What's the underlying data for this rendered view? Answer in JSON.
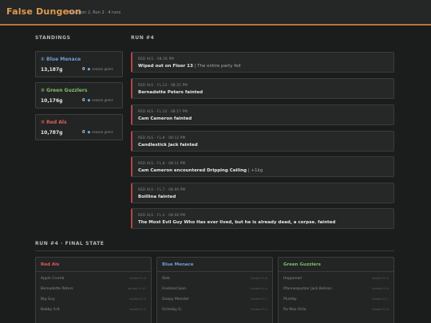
{
  "app": {
    "title": "False Dungeon",
    "subtitle": "Evolution 2, Run 2 · 4 runs"
  },
  "standings": {
    "heading": "STANDINGS",
    "teams": [
      {
        "name": "① Blue Menace",
        "gold": "13,187g",
        "gems": "0",
        "gems_label": "season gems",
        "color": "#6f9fd8"
      },
      {
        "name": "② Green Guzzlers",
        "gold": "10,176g",
        "gems": "0",
        "gems_label": "season gems",
        "color": "#7fbf6a"
      },
      {
        "name": "③ Red Als",
        "gold": "10,787g",
        "gems": "0",
        "gems_label": "season gems",
        "color": "#d9605a"
      }
    ]
  },
  "run": {
    "heading": "RUN #4",
    "events": [
      {
        "meta": "RED ALS · 08:26 PM",
        "text": "Wiped out on Floor 13",
        "extra": " | The entire party fell"
      },
      {
        "meta": "RED ALS · FL.13 · 08:25 PM",
        "text": "Bernadette Peters fainted",
        "extra": ""
      },
      {
        "meta": "RED ALS · FL.10 · 08:17 PM",
        "text": "Cam Cameron fainted",
        "extra": ""
      },
      {
        "meta": "RED ALS · FL.8 · 08:12 PM",
        "text": "Candlestick Jack fainted",
        "extra": ""
      },
      {
        "meta": "RED ALS · FL.8 · 08:11 PM",
        "text": "Cam Cameron encountered Dripping Ceiling",
        "extra": " | +1kg"
      },
      {
        "meta": "RED ALS · FL.7 · 08:09 PM",
        "text": "Boillina fainted",
        "extra": ""
      },
      {
        "meta": "RED ALS · FL.4 · 08:08 PM",
        "text": "The Most Evil Guy Who Has ever lived, but he is already dead, a corpse. fainted",
        "extra": ""
      }
    ]
  },
  "final_state": {
    "heading": "RUN #4 · FINAL STATE",
    "teams": [
      {
        "name": "Red Als",
        "color": "#d9605a",
        "members": [
          {
            "name": "Apple Crumb",
            "status": "fainted FL.6"
          },
          {
            "name": "Bernadette Peters",
            "status": "fainted FL.13"
          },
          {
            "name": "Big Guy",
            "status": "fainted FL.9"
          },
          {
            "name": "Bobby Arit",
            "status": "fainted FL.5"
          }
        ]
      },
      {
        "name": "Blue Menace",
        "color": "#6f9fd8",
        "members": [
          {
            "name": "Sleb",
            "status": "fainted FL.6"
          },
          {
            "name": "Freckled Sam",
            "status": "fainted FL.4"
          },
          {
            "name": "Goopy Monster",
            "status": "fainted FL.7"
          },
          {
            "name": "Grimsby G.",
            "status": "fainted FL.2"
          }
        ]
      },
      {
        "name": "Green Guzzlers",
        "color": "#7fbf6a",
        "members": [
          {
            "name": "Hoppenarl",
            "status": "fainted FL.9"
          },
          {
            "name": "Pfannenputzer Jack Behren",
            "status": "fainted FL.9"
          },
          {
            "name": "Plumby",
            "status": "fainted FL.7"
          },
          {
            "name": "Ra Max Orlio",
            "status": "fainted FL.5"
          }
        ]
      }
    ]
  }
}
